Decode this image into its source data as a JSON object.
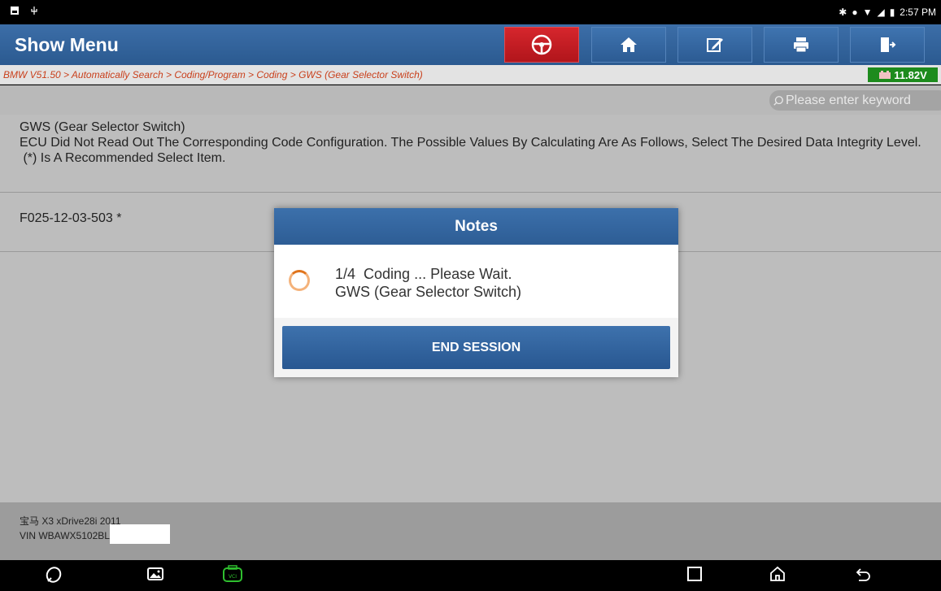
{
  "status_bar": {
    "time": "2:57 PM"
  },
  "header": {
    "title": "Show Menu"
  },
  "breadcrumb": {
    "path": "BMW V51.50 > Automatically Search > Coding/Program > Coding > GWS (Gear Selector Switch)",
    "battery_voltage": "11.82V"
  },
  "search": {
    "placeholder": "Please enter keyword"
  },
  "info": {
    "line1": "GWS (Gear Selector Switch)",
    "line2": "ECU Did Not Read Out The Corresponding Code Configuration. The Possible Values By Calculating Are As Follows, Select The Desired Data Integrity Level.",
    "line3": " (*) Is A Recommended Select Item."
  },
  "list": {
    "item1": "F025-12-03-503 *"
  },
  "footer": {
    "vehicle": "宝马 X3 xDrive28i 2011",
    "vin": "VIN WBAWX5102BL"
  },
  "dialog": {
    "title": "Notes",
    "message_line1": "1/4  Coding ... Please Wait.",
    "message_line2": "GWS (Gear Selector Switch)",
    "button": "END SESSION"
  },
  "colors": {
    "header_blue": "#2d5d95",
    "breadcrumb_red": "#c9401c",
    "battery_green": "#1d8b1d",
    "spinner_orange": "#e0741c"
  }
}
